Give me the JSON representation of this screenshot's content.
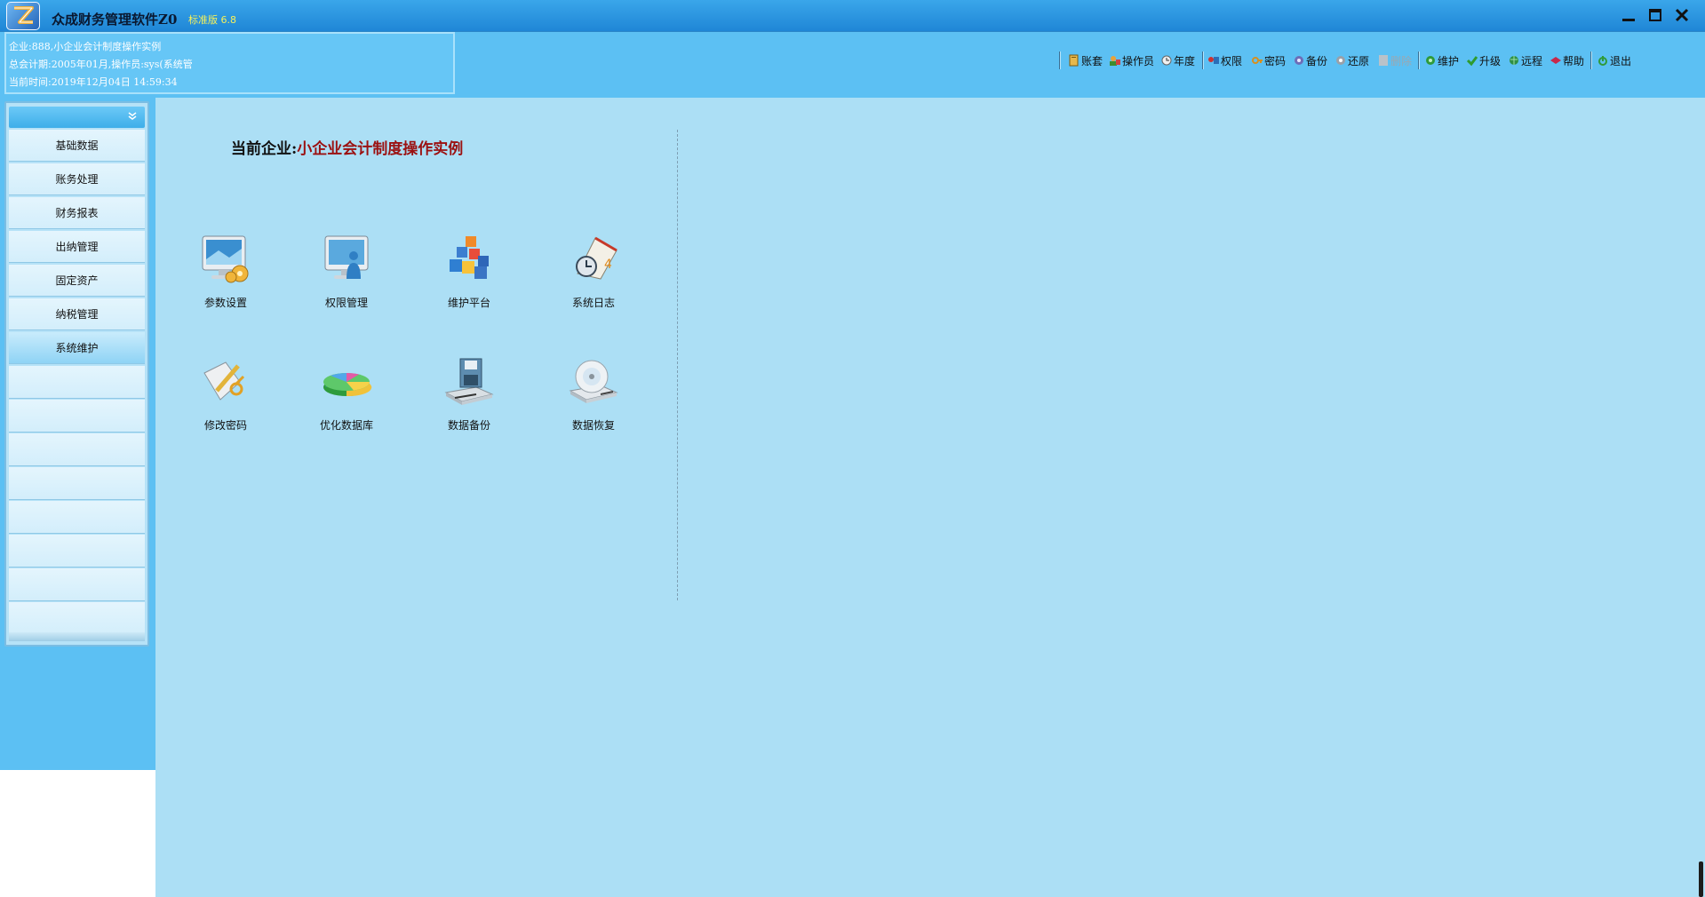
{
  "window": {
    "title": "众成财务管理软件Z0",
    "edition": "标准版 6.8",
    "minimize_icon": "minimize-icon",
    "maximize_icon": "maximize-icon",
    "close_icon": "close-icon"
  },
  "info": {
    "company_line": "企业:888,小企业会计制度操作实例",
    "period_line": "总会计期:2005年01月,操作员:sys(系统管",
    "time_line": "当前时间:2019年12月04日  14:59:34"
  },
  "toolbar": {
    "items": [
      {
        "label": "账套",
        "icon": "ledger-icon"
      },
      {
        "label": "操作员",
        "icon": "operator-icon"
      },
      {
        "label": "年度",
        "icon": "year-icon"
      },
      {
        "label": "权限",
        "icon": "permission-icon"
      },
      {
        "label": "密码",
        "icon": "password-icon"
      },
      {
        "label": "备份",
        "icon": "backup-icon"
      },
      {
        "label": "还原",
        "icon": "restore-icon"
      },
      {
        "label": "删除",
        "icon": "delete-icon",
        "disabled": true
      },
      {
        "label": "维护",
        "icon": "maintain-icon"
      },
      {
        "label": "升级",
        "icon": "upgrade-icon"
      },
      {
        "label": "远程",
        "icon": "remote-icon"
      },
      {
        "label": "帮助",
        "icon": "help-icon"
      },
      {
        "label": "退出",
        "icon": "exit-icon"
      }
    ]
  },
  "sidebar": {
    "items": [
      {
        "label": "基础数据"
      },
      {
        "label": "账务处理"
      },
      {
        "label": "财务报表"
      },
      {
        "label": "出纳管理"
      },
      {
        "label": "固定资产"
      },
      {
        "label": "纳税管理"
      },
      {
        "label": "系统维护",
        "active": true
      }
    ]
  },
  "main": {
    "company_key": "当前企业:",
    "company_value": "小企业会计制度操作实例",
    "tiles": [
      {
        "label": "参数设置",
        "icon": "parameter-settings-icon"
      },
      {
        "label": "权限管理",
        "icon": "permission-management-icon"
      },
      {
        "label": "维护平台",
        "icon": "maintenance-platform-icon"
      },
      {
        "label": "系统日志",
        "icon": "system-log-icon"
      },
      {
        "label": "修改密码",
        "icon": "change-password-icon"
      },
      {
        "label": "优化数据库",
        "icon": "optimize-database-icon"
      },
      {
        "label": "数据备份",
        "icon": "data-backup-icon"
      },
      {
        "label": "数据恢复",
        "icon": "data-restore-icon"
      }
    ]
  },
  "colors": {
    "title_bar": "#1f86d6",
    "panel_blue": "#5cc0f3",
    "content_bg": "#acdff5",
    "company_value": "#9b1111",
    "edition_text": "#f6f15a"
  }
}
